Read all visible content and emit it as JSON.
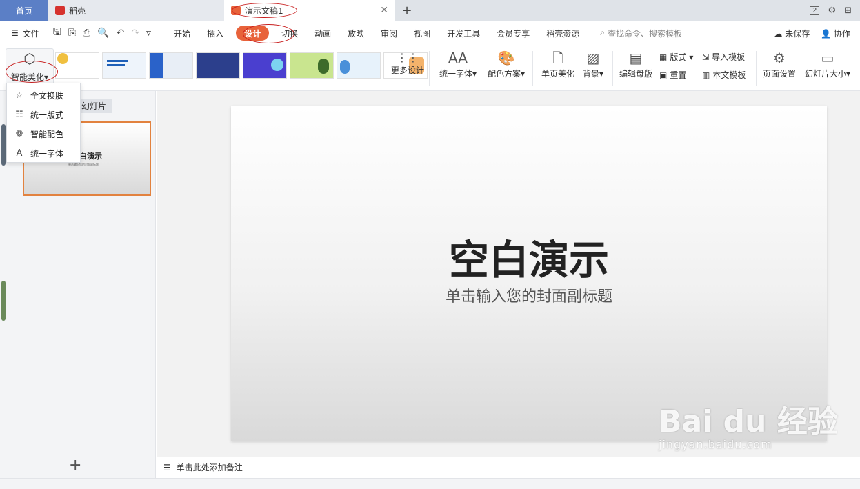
{
  "tabs": {
    "home": "首页",
    "daoke": "稻壳",
    "document": "演示文稿1",
    "badge_count": "2"
  },
  "menubar": {
    "file": "文件",
    "items": [
      "开始",
      "插入",
      "设计",
      "切换",
      "动画",
      "放映",
      "审阅",
      "视图",
      "开发工具",
      "会员专享",
      "稻壳资源"
    ],
    "active": "设计",
    "search_placeholder": "查找命令、搜索模板",
    "unsaved": "未保存",
    "collaborate": "协作"
  },
  "ribbon": {
    "smart_beautify": "智能美化",
    "more_design": "更多设计",
    "unify_font": "统一字体",
    "color_scheme": "配色方案",
    "single_page_beautify": "单页美化",
    "background": "背景",
    "edit_master": "编辑母版",
    "layout": "版式",
    "reset": "重置",
    "import_template": "导入模板",
    "this_template": "本文模板",
    "page_setup": "页面设置",
    "slide_size": "幻灯片大小"
  },
  "dropdown": {
    "items": [
      "全文换肤",
      "统一版式",
      "智能配色",
      "统一字体"
    ]
  },
  "left_panel": {
    "tab_label": "幻灯片",
    "thumb_title": "白演示"
  },
  "slide": {
    "title": "空白演示",
    "subtitle": "单击输入您的封面副标题"
  },
  "notes": {
    "placeholder": "单击此处添加备注"
  },
  "watermark": {
    "line1": "Bai du 经验",
    "line2": "jingyan.baidu.com"
  },
  "colors": {
    "accent": "#e8623a",
    "home_tab": "#5b7fc6",
    "annotation": "#c81e1e"
  }
}
